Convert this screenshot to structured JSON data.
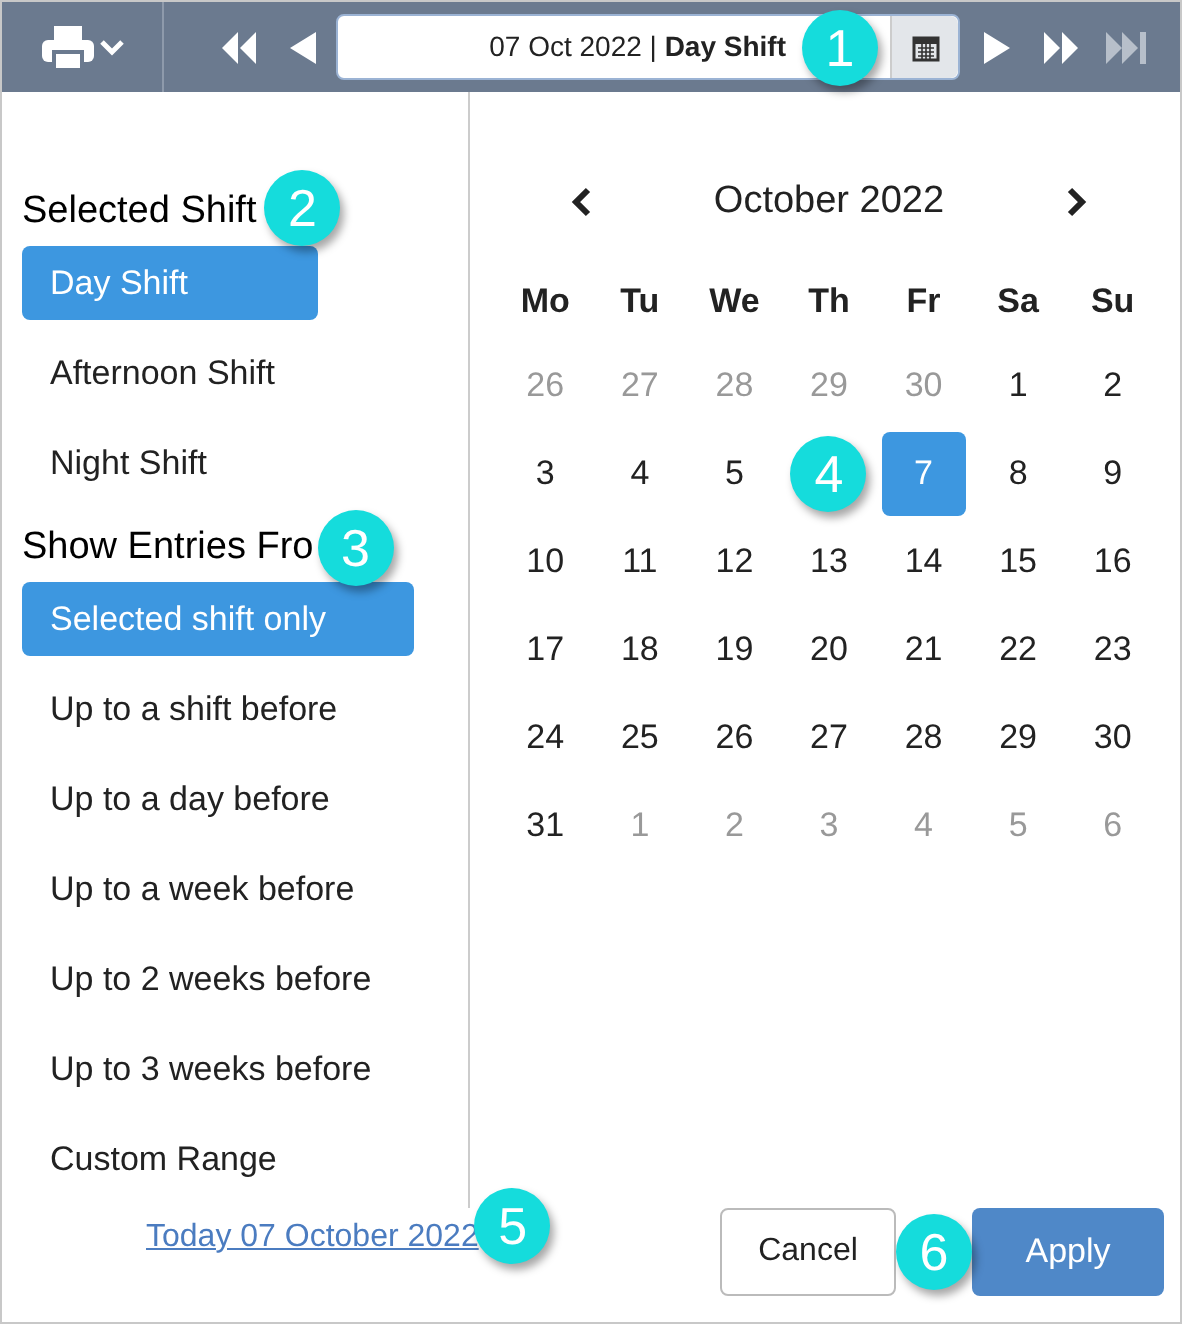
{
  "toolbar": {
    "date_field": {
      "value": "07 Oct 2022 | ",
      "shift": "Day Shift",
      "callout": "1"
    },
    "last_disabled": true
  },
  "selected_shift": {
    "title": "Selected Shift",
    "callout": "2",
    "items": [
      {
        "label": "Day Shift",
        "selected": true
      },
      {
        "label": "Afternoon Shift",
        "selected": false
      },
      {
        "label": "Night Shift",
        "selected": false
      }
    ]
  },
  "show_entries": {
    "title": "Show Entries Fro",
    "callout": "3",
    "items": [
      {
        "label": "Selected shift only",
        "selected": true
      },
      {
        "label": "Up to a shift before",
        "selected": false
      },
      {
        "label": "Up to a day before",
        "selected": false
      },
      {
        "label": "Up to a week before",
        "selected": false
      },
      {
        "label": "Up to 2 weeks before",
        "selected": false
      },
      {
        "label": "Up to 3 weeks before",
        "selected": false
      },
      {
        "label": "Custom Range",
        "selected": false
      }
    ]
  },
  "calendar": {
    "month": "October 2022",
    "weekdays": [
      "Mo",
      "Tu",
      "We",
      "Th",
      "Fr",
      "Sa",
      "Su"
    ],
    "weeks": [
      [
        {
          "kind": "day",
          "day": "26",
          "outside": true,
          "selected": false
        },
        {
          "kind": "day",
          "day": "27",
          "outside": true,
          "selected": false
        },
        {
          "kind": "day",
          "day": "28",
          "outside": true,
          "selected": false
        },
        {
          "kind": "day",
          "day": "29",
          "outside": true,
          "selected": false
        },
        {
          "kind": "day",
          "day": "30",
          "outside": true,
          "selected": false
        },
        {
          "kind": "day",
          "day": "1",
          "outside": false,
          "selected": false
        },
        {
          "kind": "day",
          "day": "2",
          "outside": false,
          "selected": false
        }
      ],
      [
        {
          "kind": "day",
          "day": "3",
          "outside": false,
          "selected": false
        },
        {
          "kind": "day",
          "day": "4",
          "outside": false,
          "selected": false
        },
        {
          "kind": "day",
          "day": "5",
          "outside": false,
          "selected": false
        },
        {
          "kind": "callout",
          "label": "4"
        },
        {
          "kind": "day",
          "day": "7",
          "outside": false,
          "selected": true
        },
        {
          "kind": "day",
          "day": "8",
          "outside": false,
          "selected": false
        },
        {
          "kind": "day",
          "day": "9",
          "outside": false,
          "selected": false
        }
      ],
      [
        {
          "kind": "day",
          "day": "10",
          "outside": false,
          "selected": false
        },
        {
          "kind": "day",
          "day": "11",
          "outside": false,
          "selected": false
        },
        {
          "kind": "day",
          "day": "12",
          "outside": false,
          "selected": false
        },
        {
          "kind": "day",
          "day": "13",
          "outside": false,
          "selected": false
        },
        {
          "kind": "day",
          "day": "14",
          "outside": false,
          "selected": false
        },
        {
          "kind": "day",
          "day": "15",
          "outside": false,
          "selected": false
        },
        {
          "kind": "day",
          "day": "16",
          "outside": false,
          "selected": false
        }
      ],
      [
        {
          "kind": "day",
          "day": "17",
          "outside": false,
          "selected": false
        },
        {
          "kind": "day",
          "day": "18",
          "outside": false,
          "selected": false
        },
        {
          "kind": "day",
          "day": "19",
          "outside": false,
          "selected": false
        },
        {
          "kind": "day",
          "day": "20",
          "outside": false,
          "selected": false
        },
        {
          "kind": "day",
          "day": "21",
          "outside": false,
          "selected": false
        },
        {
          "kind": "day",
          "day": "22",
          "outside": false,
          "selected": false
        },
        {
          "kind": "day",
          "day": "23",
          "outside": false,
          "selected": false
        }
      ],
      [
        {
          "kind": "day",
          "day": "24",
          "outside": false,
          "selected": false
        },
        {
          "kind": "day",
          "day": "25",
          "outside": false,
          "selected": false
        },
        {
          "kind": "day",
          "day": "26",
          "outside": false,
          "selected": false
        },
        {
          "kind": "day",
          "day": "27",
          "outside": false,
          "selected": false
        },
        {
          "kind": "day",
          "day": "28",
          "outside": false,
          "selected": false
        },
        {
          "kind": "day",
          "day": "29",
          "outside": false,
          "selected": false
        },
        {
          "kind": "day",
          "day": "30",
          "outside": false,
          "selected": false
        }
      ],
      [
        {
          "kind": "day",
          "day": "31",
          "outside": false,
          "selected": false
        },
        {
          "kind": "day",
          "day": "1",
          "outside": true,
          "selected": false
        },
        {
          "kind": "day",
          "day": "2",
          "outside": true,
          "selected": false
        },
        {
          "kind": "day",
          "day": "3",
          "outside": true,
          "selected": false
        },
        {
          "kind": "day",
          "day": "4",
          "outside": true,
          "selected": false
        },
        {
          "kind": "day",
          "day": "5",
          "outside": true,
          "selected": false
        },
        {
          "kind": "day",
          "day": "6",
          "outside": true,
          "selected": false
        }
      ]
    ]
  },
  "footer": {
    "today_link": "Today 07 October 2022",
    "link_callout": "5",
    "cancel": "Cancel",
    "button_callout": "6",
    "apply": "Apply"
  }
}
